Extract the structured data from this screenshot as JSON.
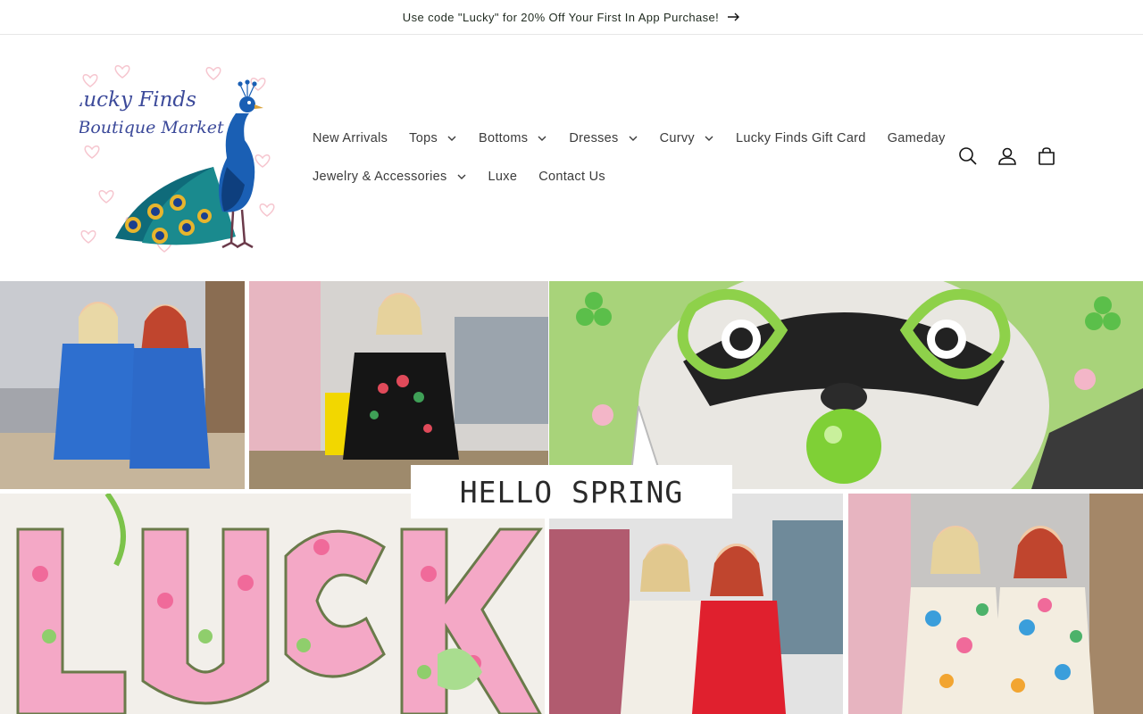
{
  "announcement": {
    "text": "Use code \"Lucky\" for 20% Off Your First In App Purchase!",
    "icon": "arrow-right-icon"
  },
  "logo": {
    "line1": "Lucky Finds",
    "line2": "Boutique Market",
    "icon": "peacock-logo"
  },
  "nav": {
    "row1": [
      {
        "label": "New Arrivals",
        "dropdown": false
      },
      {
        "label": "Tops",
        "dropdown": true
      },
      {
        "label": "Bottoms",
        "dropdown": true
      },
      {
        "label": "Dresses",
        "dropdown": true
      },
      {
        "label": "Curvy",
        "dropdown": true
      },
      {
        "label": "Lucky Finds Gift Card",
        "dropdown": false
      },
      {
        "label": "Gameday",
        "dropdown": false
      }
    ],
    "row2": [
      {
        "label": "Jewelry & Accessories",
        "dropdown": true
      },
      {
        "label": "Luxe",
        "dropdown": false
      },
      {
        "label": "Contact Us",
        "dropdown": false
      }
    ]
  },
  "header_icons": [
    "search-icon",
    "account-icon",
    "cart-icon"
  ],
  "hero": {
    "caption": "HELLO SPRING"
  },
  "colors": {
    "text": "#121212",
    "nav_text": "#3b3b3b",
    "border": "#e6e6e6",
    "accent_green": "#7cc34a",
    "accent_pink": "#f06a9a",
    "peacock_blue": "#1a5fb4"
  }
}
